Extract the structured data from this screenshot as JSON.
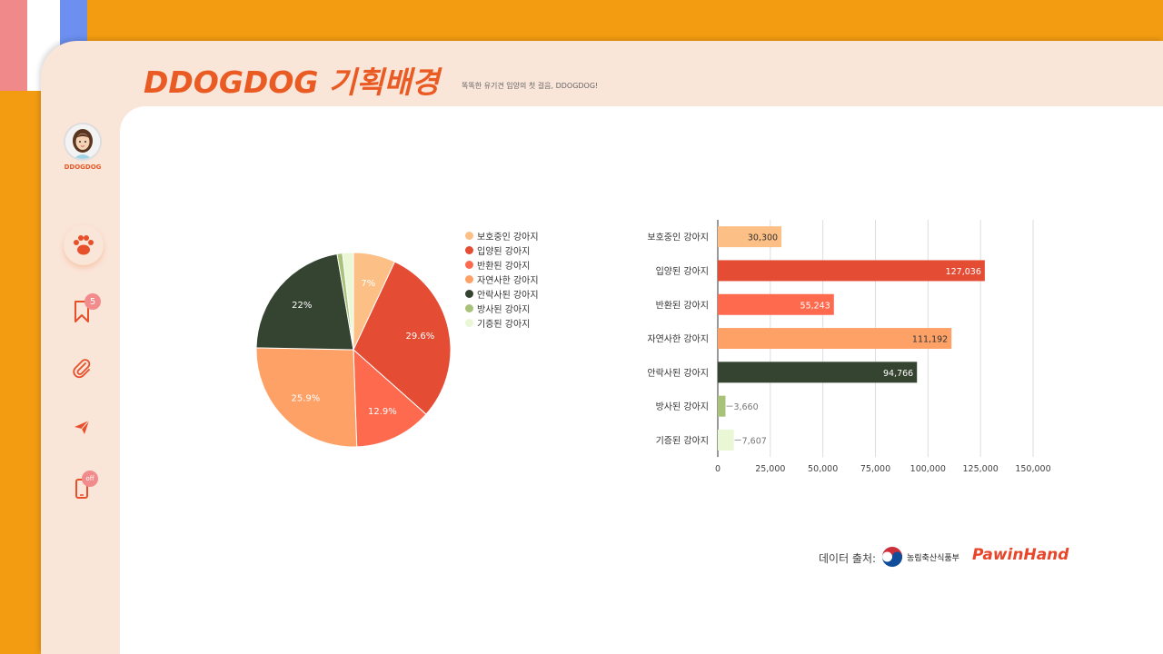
{
  "header": {
    "title": "DDOGDOG 기획배경",
    "subtitle": "똑똑한 유기견 입양의 첫 걸음, DDOGDOG!"
  },
  "sidebar": {
    "avatar_name": "DDOGDOG",
    "items": [
      {
        "icon": "paw-icon",
        "badge": ""
      },
      {
        "icon": "bookmark-icon",
        "badge": "5"
      },
      {
        "icon": "paperclip-icon",
        "badge": ""
      },
      {
        "icon": "send-icon",
        "badge": ""
      },
      {
        "icon": "phone-icon",
        "badge": "off"
      }
    ]
  },
  "colors": {
    "accent": "#ea5b24",
    "panel": "#fae5d9",
    "background": "#f39c12"
  },
  "chart_data": [
    {
      "type": "pie",
      "categories": [
        "보호중인 강아지",
        "입양된 강아지",
        "반환된 강아지",
        "자연사한 강아지",
        "안락사된 강아지",
        "방사된 강아지",
        "기증된 강아지"
      ],
      "values": [
        7,
        29.6,
        12.9,
        25.9,
        22,
        0.9,
        1.8
      ],
      "labels": [
        "7%",
        "29.6%",
        "12.9%",
        "25.9%",
        "22%",
        "",
        ""
      ],
      "colors": [
        "#fcbf85",
        "#e44c34",
        "#fd6a4e",
        "#fda167",
        "#354331",
        "#a9c27a",
        "#e9f7d4"
      ],
      "legend": "right"
    },
    {
      "type": "bar",
      "orientation": "horizontal",
      "categories": [
        "보호중인 강아지",
        "입양된 강아지",
        "반환된 강아지",
        "자연사한 강아지",
        "안락사된 강아지",
        "방사된 강아지",
        "기증된 강아지"
      ],
      "values": [
        30300,
        127036,
        55243,
        111192,
        94766,
        3660,
        7607
      ],
      "value_labels": [
        "30,300",
        "127,036",
        "55,243",
        "111,192",
        "94,766",
        "3,660",
        "7,607"
      ],
      "colors": [
        "#fcbf85",
        "#e44c34",
        "#fd6a4e",
        "#fda167",
        "#354331",
        "#a9c27a",
        "#e9f7d4"
      ],
      "xlim": [
        0,
        150000
      ],
      "xticks": [
        "0",
        "25,000",
        "50,000",
        "75,000",
        "100,000",
        "125,000",
        "150,000"
      ],
      "grid": true
    }
  ],
  "footer": {
    "source_label": "데이터 출처:",
    "gov_name": "농림축산식품부",
    "brand": "PawinHand"
  }
}
